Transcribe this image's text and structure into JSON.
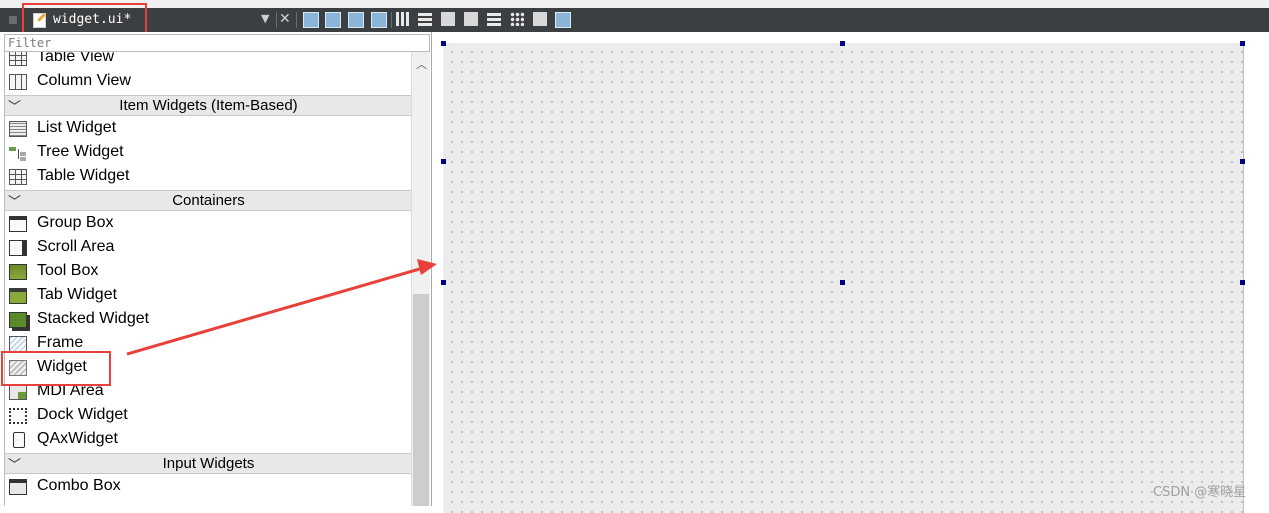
{
  "window": {
    "file_name": "widget.ui*"
  },
  "widget_box": {
    "filter_placeholder": "Filter",
    "items": [
      {
        "type": "item",
        "label": "Table View",
        "icon": "table-view-icon"
      },
      {
        "type": "item",
        "label": "Column View",
        "icon": "column-view-icon"
      },
      {
        "type": "category",
        "label": "Item Widgets (Item-Based)"
      },
      {
        "type": "item",
        "label": "List Widget",
        "icon": "list-widget-icon"
      },
      {
        "type": "item",
        "label": "Tree Widget",
        "icon": "tree-widget-icon"
      },
      {
        "type": "item",
        "label": "Table Widget",
        "icon": "table-widget-icon"
      },
      {
        "type": "category",
        "label": "Containers"
      },
      {
        "type": "item",
        "label": "Group Box",
        "icon": "group-box-icon"
      },
      {
        "type": "item",
        "label": "Scroll Area",
        "icon": "scroll-area-icon"
      },
      {
        "type": "item",
        "label": "Tool Box",
        "icon": "tool-box-icon"
      },
      {
        "type": "item",
        "label": "Tab Widget",
        "icon": "tab-widget-icon"
      },
      {
        "type": "item",
        "label": "Stacked Widget",
        "icon": "stacked-widget-icon"
      },
      {
        "type": "item",
        "label": "Frame",
        "icon": "frame-icon"
      },
      {
        "type": "item",
        "label": "Widget",
        "icon": "widget-icon"
      },
      {
        "type": "item",
        "label": "MDI Area",
        "icon": "mdi-area-icon"
      },
      {
        "type": "item",
        "label": "Dock Widget",
        "icon": "dock-widget-icon"
      },
      {
        "type": "item",
        "label": "QAxWidget",
        "icon": "qaxwidget-icon"
      },
      {
        "type": "category",
        "label": "Input Widgets"
      },
      {
        "type": "item",
        "label": "Combo Box",
        "icon": "combo-box-icon"
      }
    ]
  },
  "watermark": "CSDN @寒晓星",
  "colors": {
    "toolbar_bg": "#3c3f41",
    "annotation_red": "#e8403a",
    "selection_handle": "#000080",
    "canvas_bg": "#ececec"
  }
}
